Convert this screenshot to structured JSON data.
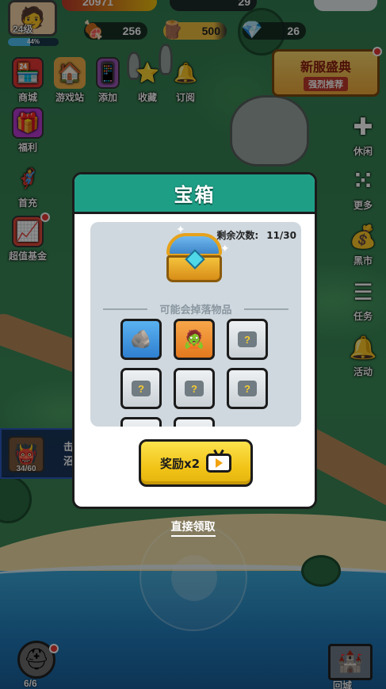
{
  "player": {
    "level": "24级",
    "xp": "44%",
    "xp_fraction": 0.44
  },
  "top_resources": {
    "coins": "20971",
    "gems": "29"
  },
  "resources": [
    {
      "icon": "meat-icon",
      "value": "256"
    },
    {
      "icon": "wood-icon",
      "value": "500"
    },
    {
      "icon": "crystal-icon",
      "value": "26"
    }
  ],
  "top_menu": [
    {
      "label": "商城",
      "icon": "shop-icon"
    },
    {
      "label": "游戏站",
      "icon": "house-icon"
    },
    {
      "label": "添加",
      "icon": "phone-icon"
    },
    {
      "label": "收藏",
      "icon": "star-icon"
    },
    {
      "label": "订阅",
      "icon": "bell-icon"
    }
  ],
  "left_menu": [
    {
      "label": "福利",
      "icon": "gift-icon"
    },
    {
      "label": "首充",
      "icon": "first-charge-icon"
    },
    {
      "label": "超值基金",
      "icon": "fund-icon"
    }
  ],
  "right_menu": [
    {
      "label": "休闲",
      "icon": "plus-icon"
    },
    {
      "label": "更多",
      "icon": "dice-icon"
    },
    {
      "label": "黑市",
      "icon": "money-bag-icon"
    },
    {
      "label": "任务",
      "icon": "task-list-icon"
    },
    {
      "label": "活动",
      "icon": "bell-icon"
    }
  ],
  "promo": {
    "title": "新服盛典",
    "subtitle": "强烈推荐"
  },
  "quest": {
    "progress": "34/60",
    "text_line1": "击",
    "text_line2": "沼"
  },
  "helmet": {
    "count": "6/6"
  },
  "castle": {
    "label": "回城"
  },
  "modal": {
    "title": "宝箱",
    "remaining_label": "剩余次数:",
    "remaining_value": "11/30",
    "drop_title": "可能会掉落物品",
    "items": [
      {
        "type": "stone",
        "style": "blue",
        "icon": "stone-icon"
      },
      {
        "type": "monster",
        "style": "orange",
        "icon": "monster-icon"
      },
      {
        "type": "unknown-weapon",
        "style": "grey",
        "icon": "dagger-unknown-icon"
      },
      {
        "type": "unknown-shield",
        "style": "grey",
        "icon": "shield-unknown-icon"
      },
      {
        "type": "unknown-ring",
        "style": "grey",
        "icon": "ring-unknown-icon"
      },
      {
        "type": "unknown-helmet",
        "style": "grey",
        "icon": "helmet-unknown-icon"
      }
    ],
    "reward_button": "奖励x2",
    "direct_claim": "直接领取"
  }
}
